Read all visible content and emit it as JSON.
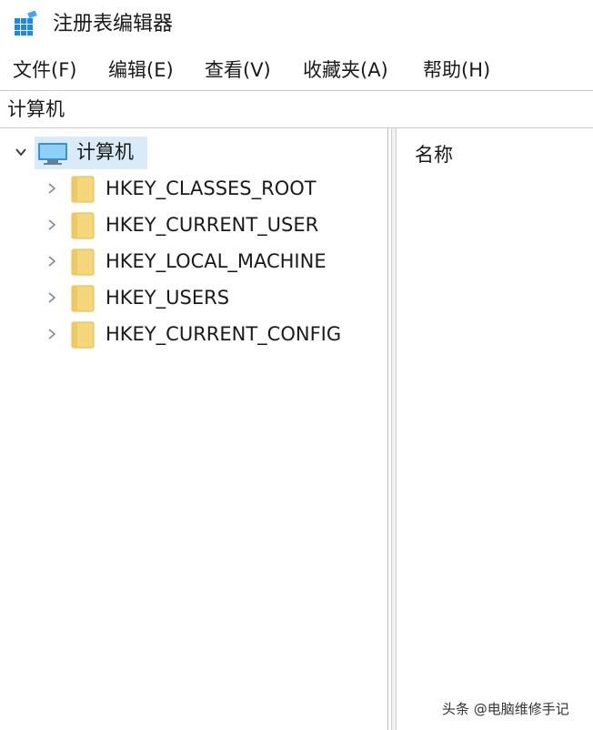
{
  "window": {
    "title": "注册表编辑器",
    "icon": "registry-editor-icon"
  },
  "menu": [
    "文件(F)",
    "编辑(E)",
    "查看(V)",
    "收藏夹(A)",
    "帮助(H)"
  ],
  "address": {
    "path": "计算机"
  },
  "tree": {
    "root": {
      "label": "计算机",
      "icon": "computer-icon",
      "expanded": true,
      "selected": true
    },
    "children": [
      {
        "label": "HKEY_CLASSES_ROOT",
        "icon": "folder-icon"
      },
      {
        "label": "HKEY_CURRENT_USER",
        "icon": "folder-icon"
      },
      {
        "label": "HKEY_LOCAL_MACHINE",
        "icon": "folder-icon"
      },
      {
        "label": "HKEY_USERS",
        "icon": "folder-icon"
      },
      {
        "label": "HKEY_CURRENT_CONFIG",
        "icon": "folder-icon"
      }
    ]
  },
  "list": {
    "columns": [
      "名称"
    ]
  },
  "watermark": "头条 @电脑维修手记",
  "colors": {
    "selection": "#d9ebf9",
    "folder": "#f4d77a",
    "folder_edge": "#e3b948",
    "accent": "#0a64c8"
  }
}
